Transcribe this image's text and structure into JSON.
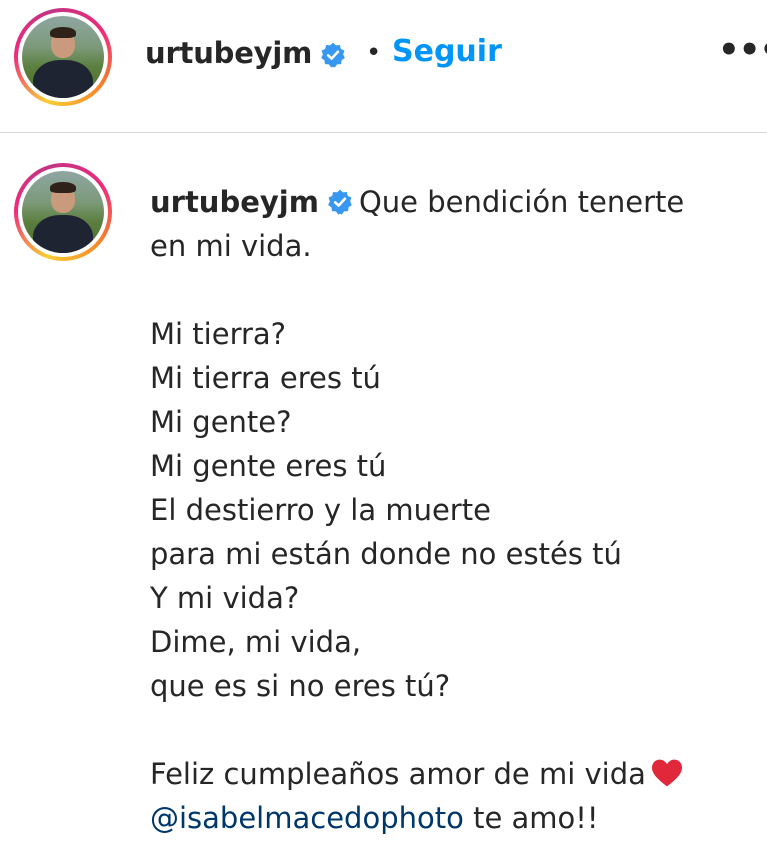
{
  "header": {
    "username": "urtubeyjm",
    "separator": "•",
    "follow_label": "Seguir",
    "more_label": "•••"
  },
  "caption": {
    "username": "urtubeyjm",
    "first_line_text": "Que bendición tenerte",
    "lines": [
      "en mi vida.",
      "",
      "Mi tierra?",
      "Mi tierra eres tú",
      "Mi gente?",
      "Mi gente eres tú",
      "El destierro y la muerte",
      "para mi están donde no estés tú",
      "Y mi vida?",
      "Dime, mi vida,",
      "que es si no eres tú?",
      ""
    ],
    "closing_text": "Feliz cumpleaños amor de mi vida",
    "mention": "@isabelmacedophoto",
    "mention_suffix": " te amo!!"
  },
  "icons": {
    "verified": "verified-badge-icon",
    "heart": "red-heart-icon",
    "more": "more-options-icon"
  },
  "colors": {
    "verified": "#3897f0",
    "follow": "#0095f6",
    "mention": "#00376b",
    "heart": "#e0283a",
    "divider": "#dbdbdb"
  }
}
